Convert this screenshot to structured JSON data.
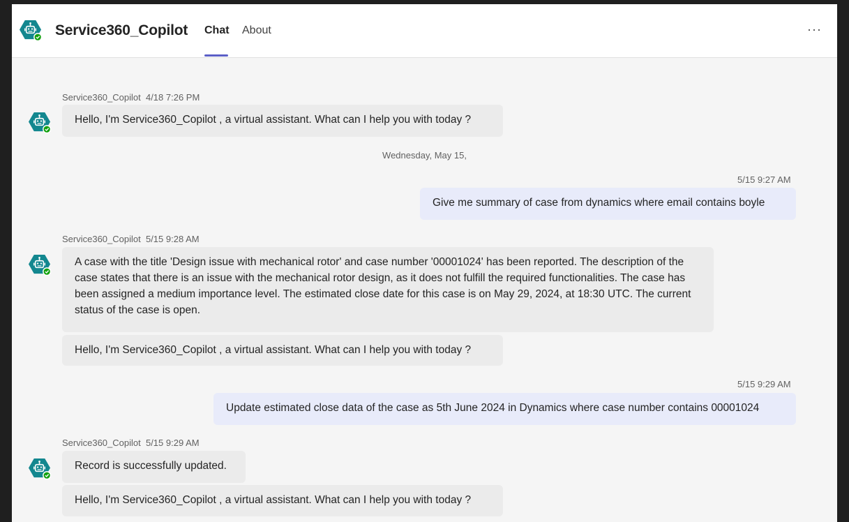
{
  "header": {
    "app_title": "Service360_Copilot",
    "tabs": [
      {
        "label": "Chat",
        "active": true
      },
      {
        "label": "About",
        "active": false
      }
    ],
    "more_label": "···"
  },
  "colors": {
    "accent": "#5b5fc7",
    "bot_avatar": "#13878f",
    "presence": "#13a10e",
    "bot_bubble": "#ebebeb",
    "user_bubble": "#e8ebfa"
  },
  "chat": {
    "date_divider": "Wednesday, May 15,",
    "messages": [
      {
        "sender": "Service360_Copilot",
        "time": "4/18 7:26 PM",
        "bubbles": [
          "Hello, I'm Service360_Copilot , a virtual assistant. What can I help you with today ?"
        ]
      },
      {
        "time": "5/15 9:27 AM",
        "text": "Give me summary of case from dynamics where email contains boyle"
      },
      {
        "sender": "Service360_Copilot",
        "time": "5/15 9:28 AM",
        "bubbles": [
          "A case with the title 'Design issue with mechanical rotor' and case number '00001024' has been reported. The description of the case states that there is an issue with the mechanical rotor design, as it does not fulfill the required functionalities. The case has been assigned a medium importance level. The estimated close date for this case is on May 29, 2024, at 18:30 UTC. The current status of the case is open.",
          "Hello, I'm Service360_Copilot , a virtual assistant. What can I help you with today ?"
        ]
      },
      {
        "time": "5/15 9:29 AM",
        "text": "Update estimated close data of the case as 5th June 2024 in Dynamics where case number contains 00001024"
      },
      {
        "sender": "Service360_Copilot",
        "time": "5/15 9:29 AM",
        "bubbles": [
          "Record is successfully updated.",
          "Hello, I'm Service360_Copilot , a virtual assistant. What can I help you with today ?"
        ]
      }
    ]
  }
}
